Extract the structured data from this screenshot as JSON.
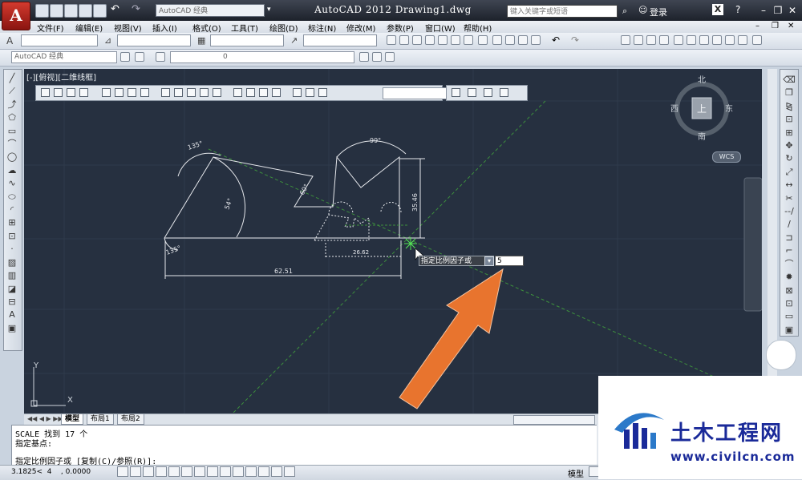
{
  "app": {
    "logo_letter": "A",
    "window_title": "AutoCAD 2012    Drawing1.dwg",
    "workspace_combo": "AutoCAD 经典",
    "search_placeholder": "键入关键字或短语",
    "login_label": "登录"
  },
  "menu": [
    "文件(F)",
    "编辑(E)",
    "视图(V)",
    "插入(I)",
    "格式(O)",
    "工具(T)",
    "绘图(D)",
    "标注(N)",
    "修改(M)",
    "参数(P)",
    "窗口(W)",
    "帮助(H)"
  ],
  "toolbar2": {
    "workspace_combo": "AutoCAD 经典",
    "layer_combo": "0"
  },
  "viewport": {
    "view_label": "[-][俯视][二维线框]"
  },
  "viewcube": {
    "north": "北",
    "south": "南",
    "east": "东",
    "west": "西",
    "top": "上",
    "wcs": "WCS"
  },
  "ucs": {
    "y_label": "Y",
    "x_label": "X"
  },
  "drawing": {
    "dims": [
      "135°",
      "99°",
      "60°",
      "54°",
      "35.46",
      "135°",
      "26.62",
      "62.51"
    ]
  },
  "dynamic_input": {
    "prompt": "指定比例因子或",
    "arrow": "▾",
    "value": "5"
  },
  "tabs": [
    "模型",
    "布局1",
    "布局2"
  ],
  "command_history": [
    "SCALE 找到 17 个",
    "指定基点:",
    "",
    "指定比例因子或 [复制(C)/参照(R)]:"
  ],
  "statusbar": {
    "coords": "3.1825<  4    , 0.0000",
    "model_label": "模型"
  },
  "watermark": {
    "brand": "土木工程网",
    "url": "www.civilcn.com"
  },
  "colors": {
    "canvas_bg": "#263040",
    "annotation_arrow": "#e8742e",
    "brand_blue": "#1a2a99"
  }
}
